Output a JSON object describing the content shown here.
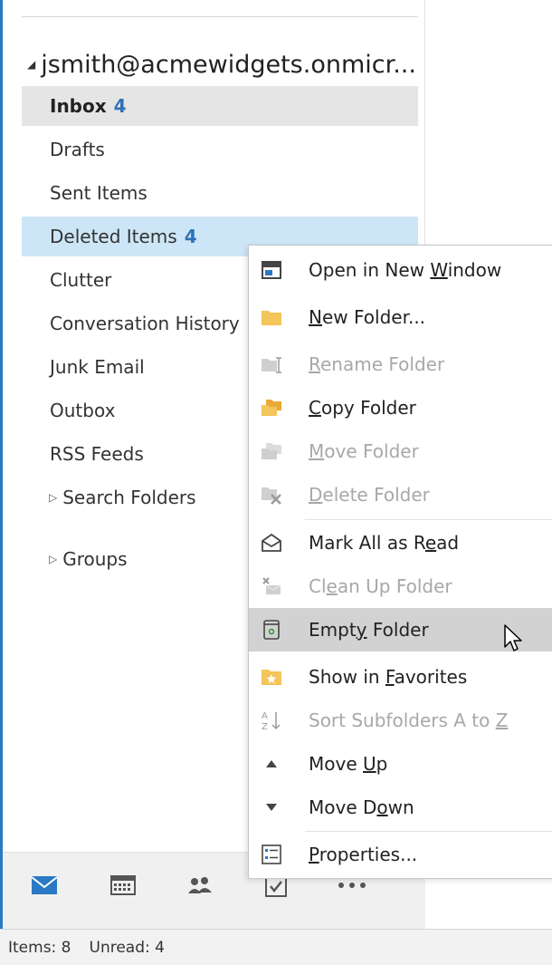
{
  "account": {
    "name": "jsmith@acmewidgets.onmicr..."
  },
  "folders": [
    {
      "label": "Inbox",
      "count": "4",
      "state": "selected"
    },
    {
      "label": "Drafts",
      "count": ""
    },
    {
      "label": "Sent Items",
      "count": ""
    },
    {
      "label": "Deleted Items",
      "count": "4",
      "state": "hover"
    },
    {
      "label": "Clutter",
      "count": ""
    },
    {
      "label": "Conversation History",
      "count": ""
    },
    {
      "label": "Junk Email",
      "count": ""
    },
    {
      "label": "Outbox",
      "count": ""
    },
    {
      "label": "RSS Feeds",
      "count": ""
    },
    {
      "label": "Search Folders",
      "count": ""
    }
  ],
  "groups": {
    "label": "Groups"
  },
  "context_menu": {
    "items": [
      {
        "pre": "Open in New ",
        "key": "W",
        "post": "indow",
        "icon": "open-new-window-icon",
        "enabled": true
      },
      {
        "pre": "",
        "key": "N",
        "post": "ew Folder...",
        "icon": "new-folder-icon",
        "enabled": true
      },
      {
        "pre": "",
        "key": "R",
        "post": "ename Folder",
        "icon": "rename-folder-icon",
        "enabled": false
      },
      {
        "pre": "",
        "key": "C",
        "post": "opy Folder",
        "icon": "copy-folder-icon",
        "enabled": true
      },
      {
        "pre": "",
        "key": "M",
        "post": "ove Folder",
        "icon": "move-folder-icon",
        "enabled": false
      },
      {
        "pre": "",
        "key": "D",
        "post": "elete Folder",
        "icon": "delete-folder-icon",
        "enabled": false
      },
      {
        "pre": "Mark All as R",
        "key": "e",
        "post": "ad",
        "icon": "mark-read-icon",
        "enabled": true
      },
      {
        "pre": "Cl",
        "key": "e",
        "post": "an Up Folder",
        "icon": "clean-up-icon",
        "enabled": false
      },
      {
        "pre": "Empt",
        "key": "y",
        "post": " Folder",
        "icon": "empty-folder-icon",
        "enabled": true,
        "highlight": true
      },
      {
        "pre": "Show in ",
        "key": "F",
        "post": "avorites",
        "icon": "favorites-icon",
        "enabled": true
      },
      {
        "pre": "Sort Subfolders A to ",
        "key": "Z",
        "post": "",
        "icon": "sort-az-icon",
        "enabled": false
      },
      {
        "pre": "Move ",
        "key": "U",
        "post": "p",
        "icon": "move-up-icon",
        "enabled": true
      },
      {
        "pre": "Move D",
        "key": "o",
        "post": "wn",
        "icon": "move-down-icon",
        "enabled": true
      },
      {
        "pre": "",
        "key": "P",
        "post": "roperties...",
        "icon": "properties-icon",
        "enabled": true
      }
    ]
  },
  "nav": [
    "mail-icon",
    "calendar-icon",
    "people-icon",
    "tasks-icon",
    "more-icon"
  ],
  "status": {
    "items_label": "Items: 8",
    "unread_label": "Unread: 4"
  },
  "colors": {
    "accent": "#2b79c5",
    "count": "#2f72b7",
    "hover": "#cde6f7",
    "selected": "#e5e5e5",
    "menu_highlight": "#d2d2d2",
    "folder_yellow": "#f3c55a"
  }
}
